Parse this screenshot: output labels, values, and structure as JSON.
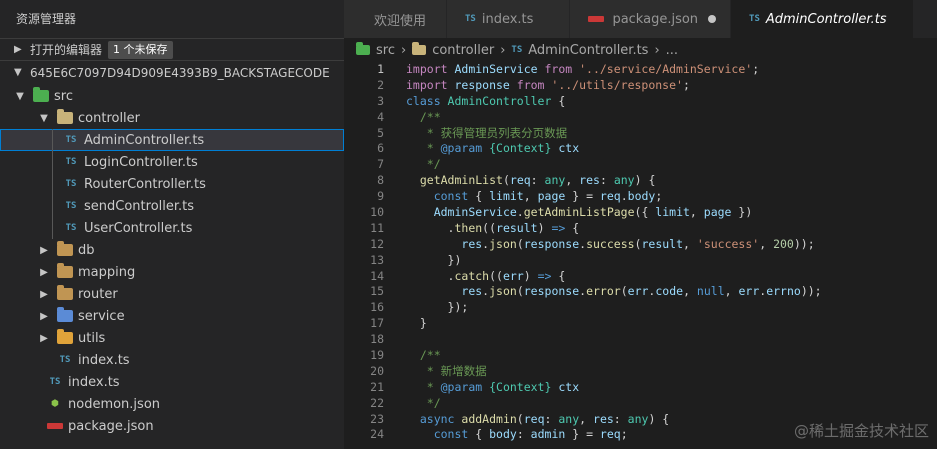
{
  "sidebar": {
    "title": "资源管理器",
    "open_editors": {
      "label": "打开的编辑器",
      "badge": "1 个未保存"
    },
    "workspace": {
      "label": "645E6C7097D94D909E4393B9_BACKSTAGECODE"
    },
    "tree": {
      "src": "src",
      "controller": "controller",
      "controller_files": [
        "AdminController.ts",
        "LoginController.ts",
        "RouterController.ts",
        "sendController.ts",
        "UserController.ts"
      ],
      "db": "db",
      "mapping": "mapping",
      "router": "router",
      "service": "service",
      "utils": "utils",
      "src_index": "index.ts",
      "root_index": "index.ts",
      "nodemon": "nodemon.json",
      "package": "package.json"
    },
    "icon_ts": "TS"
  },
  "tabs": [
    {
      "label": "欢迎使用",
      "icon": "welcome"
    },
    {
      "label": "index.ts",
      "icon": "ts-icon"
    },
    {
      "label": "package.json",
      "icon": "npm-icon",
      "dirty": true
    },
    {
      "label": "AdminController.ts",
      "icon": "ts-icon",
      "active": true
    }
  ],
  "breadcrumbs": {
    "folder1": "src",
    "folder2": "controller",
    "file": "AdminController.ts",
    "more": "..."
  },
  "editor": {
    "current_line": 1,
    "line_numbers": [
      "1",
      "2",
      "3",
      "4",
      "5",
      "6",
      "7",
      "8",
      "9",
      "10",
      "11",
      "12",
      "13",
      "14",
      "15",
      "16",
      "17",
      "18",
      "19",
      "20",
      "21",
      "22",
      "23",
      "24"
    ],
    "lines": [
      [
        [
          "kc",
          "import "
        ],
        [
          "var",
          "AdminService "
        ],
        [
          "kc",
          "from "
        ],
        [
          "str",
          "'../service/AdminService'"
        ],
        [
          "",
          "; "
        ]
      ],
      [
        [
          "kc",
          "import "
        ],
        [
          "var",
          "response "
        ],
        [
          "kc",
          "from "
        ],
        [
          "str",
          "'../utils/response'"
        ],
        [
          "",
          ";"
        ]
      ],
      [
        [
          "kw",
          "class "
        ],
        [
          "cls",
          "AdminController "
        ],
        [
          "",
          "{"
        ]
      ],
      [
        [
          "cm",
          "  /**"
        ]
      ],
      [
        [
          "cm",
          "   * 获得管理员列表分页数据"
        ]
      ],
      [
        [
          "cm",
          "   * "
        ],
        [
          "cm-tag",
          "@param "
        ],
        [
          "cm-type",
          "{Context} "
        ],
        [
          "var",
          "ctx"
        ]
      ],
      [
        [
          "cm",
          "   */"
        ]
      ],
      [
        [
          "",
          "  "
        ],
        [
          "fn",
          "getAdminList"
        ],
        [
          "",
          "("
        ],
        [
          "var",
          "req"
        ],
        [
          "",
          ": "
        ],
        [
          "cls",
          "any"
        ],
        [
          "",
          ", "
        ],
        [
          "var",
          "res"
        ],
        [
          "",
          ": "
        ],
        [
          "cls",
          "any"
        ],
        [
          "",
          ") {"
        ]
      ],
      [
        [
          "",
          "    "
        ],
        [
          "kw",
          "const "
        ],
        [
          "",
          "{ "
        ],
        [
          "var",
          "limit"
        ],
        [
          "",
          ", "
        ],
        [
          "var",
          "page "
        ],
        [
          "",
          "} = "
        ],
        [
          "var",
          "req"
        ],
        [
          "",
          "."
        ],
        [
          "var",
          "body"
        ],
        [
          "",
          ";"
        ]
      ],
      [
        [
          "",
          "    "
        ],
        [
          "var",
          "AdminService"
        ],
        [
          "",
          "."
        ],
        [
          "fn",
          "getAdminListPage"
        ],
        [
          "",
          "({ "
        ],
        [
          "var",
          "limit"
        ],
        [
          "",
          ", "
        ],
        [
          "var",
          "page "
        ],
        [
          "",
          "})"
        ]
      ],
      [
        [
          "",
          "      ."
        ],
        [
          "fn",
          "then"
        ],
        [
          "",
          "(("
        ],
        [
          "var",
          "result"
        ],
        [
          "",
          ") "
        ],
        [
          "kw",
          "=>"
        ],
        [
          "",
          " {"
        ]
      ],
      [
        [
          "",
          "        "
        ],
        [
          "var",
          "res"
        ],
        [
          "",
          "."
        ],
        [
          "fn",
          "json"
        ],
        [
          "",
          "("
        ],
        [
          "var",
          "response"
        ],
        [
          "",
          "."
        ],
        [
          "fn",
          "success"
        ],
        [
          "",
          "("
        ],
        [
          "var",
          "result"
        ],
        [
          "",
          ", "
        ],
        [
          "str",
          "'success'"
        ],
        [
          "",
          ", "
        ],
        [
          "num",
          "200"
        ],
        [
          "",
          "));"
        ]
      ],
      [
        [
          "",
          "      })"
        ]
      ],
      [
        [
          "",
          "      ."
        ],
        [
          "fn",
          "catch"
        ],
        [
          "",
          "(("
        ],
        [
          "var",
          "err"
        ],
        [
          "",
          ") "
        ],
        [
          "kw",
          "=>"
        ],
        [
          "",
          " {"
        ]
      ],
      [
        [
          "",
          "        "
        ],
        [
          "var",
          "res"
        ],
        [
          "",
          "."
        ],
        [
          "fn",
          "json"
        ],
        [
          "",
          "("
        ],
        [
          "var",
          "response"
        ],
        [
          "",
          "."
        ],
        [
          "fn",
          "error"
        ],
        [
          "",
          "("
        ],
        [
          "var",
          "err"
        ],
        [
          "",
          "."
        ],
        [
          "var",
          "code"
        ],
        [
          "",
          ", "
        ],
        [
          "kw",
          "null"
        ],
        [
          "",
          ", "
        ],
        [
          "var",
          "err"
        ],
        [
          "",
          "."
        ],
        [
          "var",
          "errno"
        ],
        [
          "",
          "));"
        ]
      ],
      [
        [
          "",
          "      });"
        ]
      ],
      [
        [
          "",
          "  }"
        ]
      ],
      [
        [
          "",
          ""
        ]
      ],
      [
        [
          "cm",
          "  /**"
        ]
      ],
      [
        [
          "cm",
          "   * 新增数据"
        ]
      ],
      [
        [
          "cm",
          "   * "
        ],
        [
          "cm-tag",
          "@param "
        ],
        [
          "cm-type",
          "{Context} "
        ],
        [
          "var",
          "ctx"
        ]
      ],
      [
        [
          "cm",
          "   */"
        ]
      ],
      [
        [
          "",
          "  "
        ],
        [
          "kw",
          "async "
        ],
        [
          "fn",
          "addAdmin"
        ],
        [
          "",
          "("
        ],
        [
          "var",
          "req"
        ],
        [
          "",
          ": "
        ],
        [
          "cls",
          "any"
        ],
        [
          "",
          ", "
        ],
        [
          "var",
          "res"
        ],
        [
          "",
          ": "
        ],
        [
          "cls",
          "any"
        ],
        [
          "",
          ") {"
        ]
      ],
      [
        [
          "",
          "    "
        ],
        [
          "kw",
          "const "
        ],
        [
          "",
          "{ "
        ],
        [
          "var",
          "body"
        ],
        [
          "",
          ": "
        ],
        [
          "var",
          "admin "
        ],
        [
          "",
          "} = "
        ],
        [
          "var",
          "req"
        ],
        [
          "",
          ";"
        ]
      ]
    ]
  },
  "watermark": "@稀土掘金技术社区"
}
